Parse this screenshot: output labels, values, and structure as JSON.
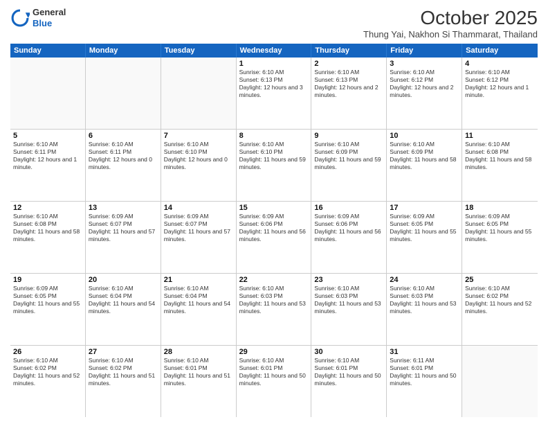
{
  "logo": {
    "general": "General",
    "blue": "Blue"
  },
  "header": {
    "month": "October 2025",
    "location": "Thung Yai, Nakhon Si Thammarat, Thailand"
  },
  "days": [
    "Sunday",
    "Monday",
    "Tuesday",
    "Wednesday",
    "Thursday",
    "Friday",
    "Saturday"
  ],
  "weeks": [
    [
      {
        "day": "",
        "text": ""
      },
      {
        "day": "",
        "text": ""
      },
      {
        "day": "",
        "text": ""
      },
      {
        "day": "1",
        "text": "Sunrise: 6:10 AM\nSunset: 6:13 PM\nDaylight: 12 hours and 3 minutes."
      },
      {
        "day": "2",
        "text": "Sunrise: 6:10 AM\nSunset: 6:13 PM\nDaylight: 12 hours and 2 minutes."
      },
      {
        "day": "3",
        "text": "Sunrise: 6:10 AM\nSunset: 6:12 PM\nDaylight: 12 hours and 2 minutes."
      },
      {
        "day": "4",
        "text": "Sunrise: 6:10 AM\nSunset: 6:12 PM\nDaylight: 12 hours and 1 minute."
      }
    ],
    [
      {
        "day": "5",
        "text": "Sunrise: 6:10 AM\nSunset: 6:11 PM\nDaylight: 12 hours and 1 minute."
      },
      {
        "day": "6",
        "text": "Sunrise: 6:10 AM\nSunset: 6:11 PM\nDaylight: 12 hours and 0 minutes."
      },
      {
        "day": "7",
        "text": "Sunrise: 6:10 AM\nSunset: 6:10 PM\nDaylight: 12 hours and 0 minutes."
      },
      {
        "day": "8",
        "text": "Sunrise: 6:10 AM\nSunset: 6:10 PM\nDaylight: 11 hours and 59 minutes."
      },
      {
        "day": "9",
        "text": "Sunrise: 6:10 AM\nSunset: 6:09 PM\nDaylight: 11 hours and 59 minutes."
      },
      {
        "day": "10",
        "text": "Sunrise: 6:10 AM\nSunset: 6:09 PM\nDaylight: 11 hours and 58 minutes."
      },
      {
        "day": "11",
        "text": "Sunrise: 6:10 AM\nSunset: 6:08 PM\nDaylight: 11 hours and 58 minutes."
      }
    ],
    [
      {
        "day": "12",
        "text": "Sunrise: 6:10 AM\nSunset: 6:08 PM\nDaylight: 11 hours and 58 minutes."
      },
      {
        "day": "13",
        "text": "Sunrise: 6:09 AM\nSunset: 6:07 PM\nDaylight: 11 hours and 57 minutes."
      },
      {
        "day": "14",
        "text": "Sunrise: 6:09 AM\nSunset: 6:07 PM\nDaylight: 11 hours and 57 minutes."
      },
      {
        "day": "15",
        "text": "Sunrise: 6:09 AM\nSunset: 6:06 PM\nDaylight: 11 hours and 56 minutes."
      },
      {
        "day": "16",
        "text": "Sunrise: 6:09 AM\nSunset: 6:06 PM\nDaylight: 11 hours and 56 minutes."
      },
      {
        "day": "17",
        "text": "Sunrise: 6:09 AM\nSunset: 6:05 PM\nDaylight: 11 hours and 55 minutes."
      },
      {
        "day": "18",
        "text": "Sunrise: 6:09 AM\nSunset: 6:05 PM\nDaylight: 11 hours and 55 minutes."
      }
    ],
    [
      {
        "day": "19",
        "text": "Sunrise: 6:09 AM\nSunset: 6:05 PM\nDaylight: 11 hours and 55 minutes."
      },
      {
        "day": "20",
        "text": "Sunrise: 6:10 AM\nSunset: 6:04 PM\nDaylight: 11 hours and 54 minutes."
      },
      {
        "day": "21",
        "text": "Sunrise: 6:10 AM\nSunset: 6:04 PM\nDaylight: 11 hours and 54 minutes."
      },
      {
        "day": "22",
        "text": "Sunrise: 6:10 AM\nSunset: 6:03 PM\nDaylight: 11 hours and 53 minutes."
      },
      {
        "day": "23",
        "text": "Sunrise: 6:10 AM\nSunset: 6:03 PM\nDaylight: 11 hours and 53 minutes."
      },
      {
        "day": "24",
        "text": "Sunrise: 6:10 AM\nSunset: 6:03 PM\nDaylight: 11 hours and 53 minutes."
      },
      {
        "day": "25",
        "text": "Sunrise: 6:10 AM\nSunset: 6:02 PM\nDaylight: 11 hours and 52 minutes."
      }
    ],
    [
      {
        "day": "26",
        "text": "Sunrise: 6:10 AM\nSunset: 6:02 PM\nDaylight: 11 hours and 52 minutes."
      },
      {
        "day": "27",
        "text": "Sunrise: 6:10 AM\nSunset: 6:02 PM\nDaylight: 11 hours and 51 minutes."
      },
      {
        "day": "28",
        "text": "Sunrise: 6:10 AM\nSunset: 6:01 PM\nDaylight: 11 hours and 51 minutes."
      },
      {
        "day": "29",
        "text": "Sunrise: 6:10 AM\nSunset: 6:01 PM\nDaylight: 11 hours and 50 minutes."
      },
      {
        "day": "30",
        "text": "Sunrise: 6:10 AM\nSunset: 6:01 PM\nDaylight: 11 hours and 50 minutes."
      },
      {
        "day": "31",
        "text": "Sunrise: 6:11 AM\nSunset: 6:01 PM\nDaylight: 11 hours and 50 minutes."
      },
      {
        "day": "",
        "text": ""
      }
    ]
  ]
}
